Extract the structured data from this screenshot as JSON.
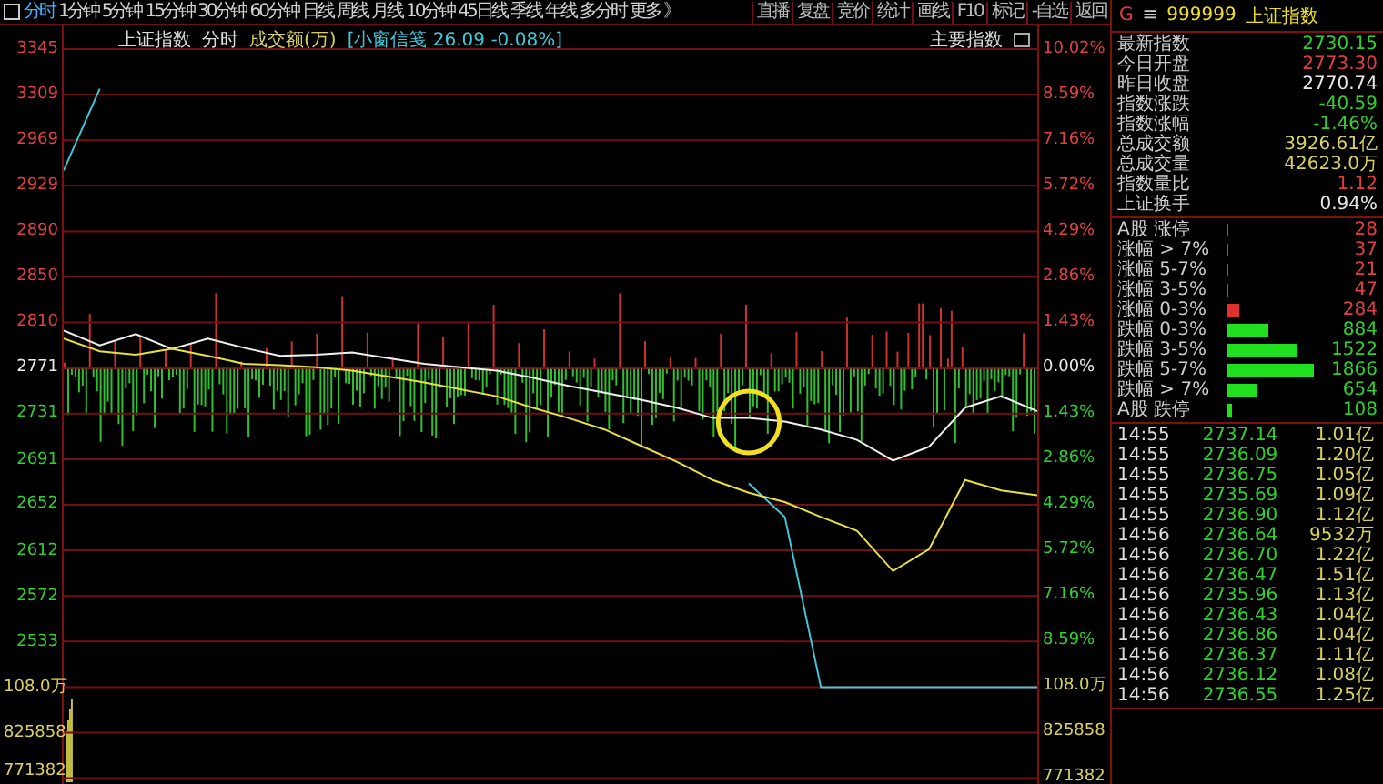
{
  "toolbar": {
    "periods": [
      {
        "label": "分时",
        "selected": true
      },
      {
        "label": "1分钟",
        "selected": false
      },
      {
        "label": "5分钟",
        "selected": false
      },
      {
        "label": "15分钟",
        "selected": false
      },
      {
        "label": "30分钟",
        "selected": false
      },
      {
        "label": "60分钟",
        "selected": false
      },
      {
        "label": "日线",
        "selected": false
      },
      {
        "label": "周线",
        "selected": false
      },
      {
        "label": "月线",
        "selected": false
      },
      {
        "label": "10分钟",
        "selected": false
      },
      {
        "label": "45日线",
        "selected": false
      },
      {
        "label": "季线",
        "selected": false
      },
      {
        "label": "年线",
        "selected": false
      },
      {
        "label": "多分时",
        "selected": false
      },
      {
        "label": "更多 》",
        "selected": false
      }
    ],
    "tools": [
      "直播",
      "复盘",
      "竞价",
      "统计",
      "画线",
      "F10",
      "标记",
      "-自选",
      "返回"
    ]
  },
  "chart": {
    "index_name": "上证指数",
    "mode": "分时",
    "volume_label": "成交额(万)",
    "info": "[小窗信笺 26.09 -0.08%]",
    "indices_button": "主要指数",
    "chart_data": {
      "type": "line",
      "ylim": [
        2409,
        3068
      ],
      "grid": true,
      "yticks": [
        {
          "value": 2969,
          "label": "2969"
        },
        {
          "value": 2929,
          "label": "2929"
        },
        {
          "value": 2890,
          "label": "2890"
        },
        {
          "value": 2850,
          "label": "2850"
        },
        {
          "value": 2810,
          "label": "2810"
        },
        {
          "value": 2771,
          "label": "2771"
        },
        {
          "value": 2731,
          "label": "2731"
        },
        {
          "value": 2691,
          "label": "2691"
        },
        {
          "value": 2652,
          "label": "2652"
        },
        {
          "value": 2612,
          "label": "2612"
        },
        {
          "value": 2572,
          "label": "2572"
        },
        {
          "value": 2533,
          "label": "2533"
        }
      ],
      "series": [
        {
          "color": "#40c8d8",
          "values": [
            2942,
            3013,
            null,
            null,
            null,
            null,
            null,
            null,
            null,
            null,
            null,
            null,
            null,
            null,
            null,
            null,
            null,
            null,
            null,
            2670,
            2641,
            2493,
            2493,
            2493,
            2493,
            2493,
            2493,
            2493
          ]
        },
        {
          "color": "#f0f0f0",
          "values": [
            2803,
            2790,
            2800,
            2787,
            2796,
            2788,
            2781,
            2782,
            2784,
            2779,
            2774,
            2771,
            2768,
            2762,
            2755,
            2749,
            2743,
            2736,
            2727,
            2727,
            2724,
            2717,
            2708,
            2690,
            2702,
            2736,
            2746,
            2733
          ]
        },
        {
          "color": "#e8e040",
          "values": [
            2796,
            2785,
            2782,
            2787,
            2781,
            2774,
            2773,
            2771,
            2768,
            2763,
            2758,
            2752,
            2746,
            2736,
            2727,
            2717,
            2703,
            2689,
            2673,
            2662,
            2654,
            2641,
            2629,
            2594,
            2613,
            2673,
            2664,
            2660
          ]
        }
      ]
    },
    "top_axis_labels": [
      "3345",
      "3309"
    ],
    "volume_axis": [
      {
        "label": "108.0万",
        "kind": "volume"
      },
      {
        "label": "825858",
        "kind": "volume"
      },
      {
        "label": "771382",
        "kind": "volume"
      }
    ],
    "right_axis": [
      {
        "label": "10.02%",
        "kind": "up"
      },
      {
        "label": "8.59%",
        "kind": "up"
      },
      {
        "label": "7.16%",
        "kind": "up"
      },
      {
        "label": "5.72%",
        "kind": "up"
      },
      {
        "label": "4.29%",
        "kind": "up"
      },
      {
        "label": "2.86%",
        "kind": "up"
      },
      {
        "label": "1.43%",
        "kind": "up"
      },
      {
        "label": "0.00%",
        "kind": "flat"
      },
      {
        "label": "1.43%",
        "kind": "down"
      },
      {
        "label": "2.86%",
        "kind": "down"
      },
      {
        "label": "4.29%",
        "kind": "down"
      },
      {
        "label": "5.72%",
        "kind": "down"
      },
      {
        "label": "7.16%",
        "kind": "down"
      },
      {
        "label": "8.59%",
        "kind": "down"
      },
      {
        "label": "108.0万",
        "kind": "volume"
      },
      {
        "label": "825858",
        "kind": "volume"
      },
      {
        "label": "771382",
        "kind": "volume"
      }
    ]
  },
  "quote": {
    "prefix": "G",
    "menu_glyph": "≡",
    "code": "999999",
    "name": "上证指数",
    "stats": [
      {
        "label": "最新指数",
        "value": "2730.15",
        "kind": "down"
      },
      {
        "label": "今日开盘",
        "value": "2773.30",
        "kind": "up"
      },
      {
        "label": "昨日收盘",
        "value": "2770.74",
        "kind": "flat"
      },
      {
        "label": "指数涨跌",
        "value": "-40.59",
        "kind": "down"
      },
      {
        "label": "指数涨幅",
        "value": "-1.46%",
        "kind": "down"
      },
      {
        "label": "总成交额",
        "value": "3926.61亿",
        "kind": "amount"
      },
      {
        "label": "总成交量",
        "value": "42623.0万",
        "kind": "amount"
      },
      {
        "label": "指数量比",
        "value": "1.12",
        "kind": "up"
      },
      {
        "label": "上证换手",
        "value": "0.94%",
        "kind": "flat"
      }
    ],
    "breadth": [
      {
        "label": "A股 涨停",
        "value": "28",
        "kind": "up"
      },
      {
        "label": "涨幅 > 7%",
        "value": "37",
        "kind": "up"
      },
      {
        "label": "涨幅 5-7%",
        "value": "21",
        "kind": "up"
      },
      {
        "label": "涨幅 3-5%",
        "value": "47",
        "kind": "up"
      },
      {
        "label": "涨幅 0-3%",
        "value": "284",
        "kind": "up"
      },
      {
        "label": "跌幅 0-3%",
        "value": "884",
        "kind": "down"
      },
      {
        "label": "跌幅 3-5%",
        "value": "1522",
        "kind": "down"
      },
      {
        "label": "跌幅 5-7%",
        "value": "1866",
        "kind": "down"
      },
      {
        "label": "跌幅 > 7%",
        "value": "654",
        "kind": "down"
      },
      {
        "label": "A股 跌停",
        "value": "108",
        "kind": "down"
      }
    ],
    "ticks": [
      {
        "time": "14:55",
        "price": "2737.14",
        "amount": "1.01亿"
      },
      {
        "time": "14:55",
        "price": "2736.09",
        "amount": "1.20亿"
      },
      {
        "time": "14:55",
        "price": "2736.75",
        "amount": "1.05亿"
      },
      {
        "time": "14:55",
        "price": "2735.69",
        "amount": "1.09亿"
      },
      {
        "time": "14:55",
        "price": "2736.90",
        "amount": "1.12亿"
      },
      {
        "time": "14:56",
        "price": "2736.64",
        "amount": "9532万"
      },
      {
        "time": "14:56",
        "price": "2736.70",
        "amount": "1.22亿"
      },
      {
        "time": "14:56",
        "price": "2736.47",
        "amount": "1.51亿"
      },
      {
        "time": "14:56",
        "price": "2735.96",
        "amount": "1.13亿"
      },
      {
        "time": "14:56",
        "price": "2736.43",
        "amount": "1.04亿"
      },
      {
        "time": "14:56",
        "price": "2736.86",
        "amount": "1.04亿"
      },
      {
        "time": "14:56",
        "price": "2736.37",
        "amount": "1.11亿"
      },
      {
        "time": "14:56",
        "price": "2736.12",
        "amount": "1.08亿"
      },
      {
        "time": "14:56",
        "price": "2736.55",
        "amount": "1.25亿"
      }
    ]
  }
}
